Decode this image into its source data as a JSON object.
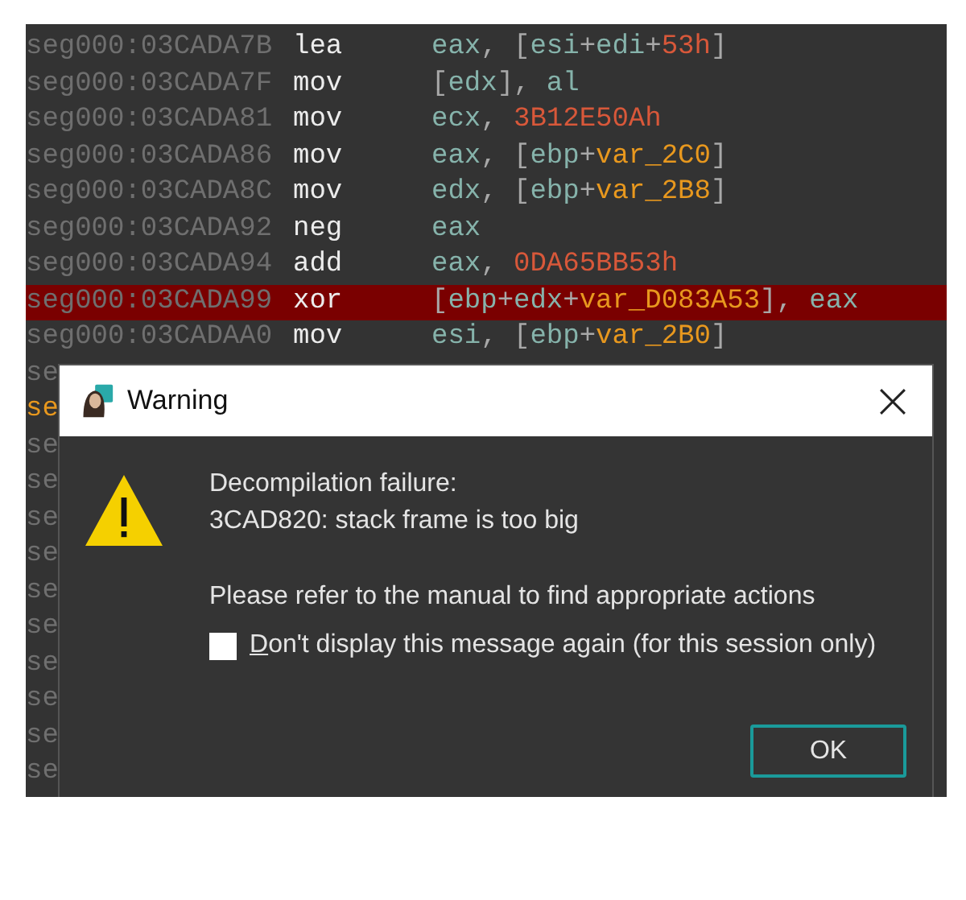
{
  "listing": {
    "lines": [
      {
        "address": "seg000:03CADA7B",
        "mnemonic": "lea",
        "selected": false,
        "operands": [
          {
            "t": "eax",
            "kind": "reg"
          },
          {
            "t": ", [",
            "kind": "punct"
          },
          {
            "t": "esi",
            "kind": "reg"
          },
          {
            "t": "+",
            "kind": "punct"
          },
          {
            "t": "edi",
            "kind": "reg"
          },
          {
            "t": "+",
            "kind": "punct"
          },
          {
            "t": "53h",
            "kind": "num"
          },
          {
            "t": "]",
            "kind": "punct"
          }
        ]
      },
      {
        "address": "seg000:03CADA7F",
        "mnemonic": "mov",
        "selected": false,
        "operands": [
          {
            "t": "[",
            "kind": "punct"
          },
          {
            "t": "edx",
            "kind": "reg"
          },
          {
            "t": "], ",
            "kind": "punct"
          },
          {
            "t": "al",
            "kind": "reg"
          }
        ]
      },
      {
        "address": "seg000:03CADA81",
        "mnemonic": "mov",
        "selected": false,
        "operands": [
          {
            "t": "ecx",
            "kind": "reg"
          },
          {
            "t": ", ",
            "kind": "punct"
          },
          {
            "t": "3B12E50Ah",
            "kind": "num"
          }
        ]
      },
      {
        "address": "seg000:03CADA86",
        "mnemonic": "mov",
        "selected": false,
        "operands": [
          {
            "t": "eax",
            "kind": "reg"
          },
          {
            "t": ", [",
            "kind": "punct"
          },
          {
            "t": "ebp",
            "kind": "reg"
          },
          {
            "t": "+",
            "kind": "punct"
          },
          {
            "t": "var_2C0",
            "kind": "var"
          },
          {
            "t": "]",
            "kind": "punct"
          }
        ]
      },
      {
        "address": "seg000:03CADA8C",
        "mnemonic": "mov",
        "selected": false,
        "operands": [
          {
            "t": "edx",
            "kind": "reg"
          },
          {
            "t": ", [",
            "kind": "punct"
          },
          {
            "t": "ebp",
            "kind": "reg"
          },
          {
            "t": "+",
            "kind": "punct"
          },
          {
            "t": "var_2B8",
            "kind": "var"
          },
          {
            "t": "]",
            "kind": "punct"
          }
        ]
      },
      {
        "address": "seg000:03CADA92",
        "mnemonic": "neg",
        "selected": false,
        "operands": [
          {
            "t": "eax",
            "kind": "reg"
          }
        ]
      },
      {
        "address": "seg000:03CADA94",
        "mnemonic": "add",
        "selected": false,
        "operands": [
          {
            "t": "eax",
            "kind": "reg"
          },
          {
            "t": ", ",
            "kind": "punct"
          },
          {
            "t": "0DA65BB53h",
            "kind": "num"
          }
        ]
      },
      {
        "address": "seg000:03CADA99",
        "mnemonic": "xor",
        "selected": true,
        "operands": [
          {
            "t": "[",
            "kind": "punct"
          },
          {
            "t": "ebp",
            "kind": "reg"
          },
          {
            "t": "+",
            "kind": "punct"
          },
          {
            "t": "edx",
            "kind": "reg"
          },
          {
            "t": "+",
            "kind": "punct"
          },
          {
            "t": "var_D083A53",
            "kind": "var"
          },
          {
            "t": "], ",
            "kind": "punct"
          },
          {
            "t": "eax",
            "kind": "reg"
          }
        ]
      },
      {
        "address": "seg000:03CADAA0",
        "mnemonic": "mov",
        "selected": false,
        "operands": [
          {
            "t": "esi",
            "kind": "reg"
          },
          {
            "t": ", [",
            "kind": "punct"
          },
          {
            "t": "ebp",
            "kind": "reg"
          },
          {
            "t": "+",
            "kind": "punct"
          },
          {
            "t": "var_2B0",
            "kind": "var"
          },
          {
            "t": "]",
            "kind": "punct"
          }
        ]
      }
    ],
    "covered_lines": [
      {
        "text": "se",
        "kind": "code"
      },
      {
        "text": "se",
        "kind": "label"
      },
      {
        "text": "se",
        "kind": "code"
      },
      {
        "text": "se",
        "kind": "code"
      },
      {
        "text": "se",
        "kind": "code"
      },
      {
        "text": "se",
        "kind": "code"
      },
      {
        "text": "se",
        "kind": "code"
      },
      {
        "text": "se",
        "kind": "code"
      },
      {
        "text": "se",
        "kind": "code"
      },
      {
        "text": "se",
        "kind": "code"
      },
      {
        "text": "se",
        "kind": "code"
      },
      {
        "text": "se",
        "kind": "code"
      }
    ]
  },
  "dialog": {
    "title": "Warning",
    "message_lines": [
      "Decompilation failure:",
      "3CAD820: stack frame is too big"
    ],
    "hint": "Please refer to the manual to find appropriate actions",
    "checkbox": {
      "label": "Don't display this message again (for this session only)",
      "checked": false
    },
    "buttons": [
      "OK"
    ]
  }
}
